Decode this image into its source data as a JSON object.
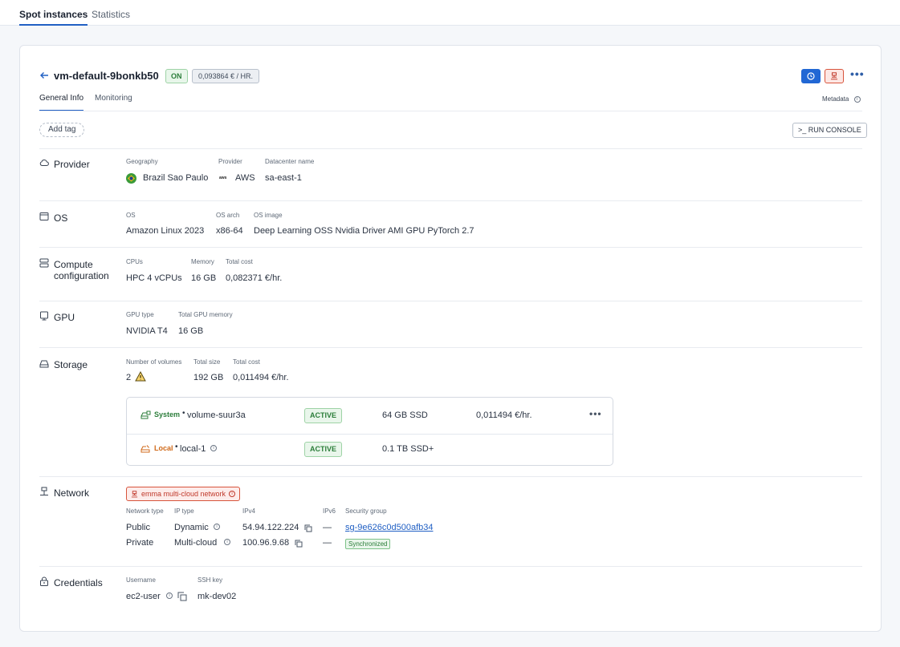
{
  "topnav": {
    "tabs": [
      "Spot instances",
      "Statistics"
    ]
  },
  "header": {
    "vm_name": "vm-default-9bonkb50",
    "status": "ON",
    "price": "0,093864 € / HR.",
    "tabs": [
      "General Info",
      "Monitoring"
    ],
    "metadata_label": "Metadata",
    "add_tag": "Add tag",
    "run_console": ">_ RUN CONSOLE"
  },
  "provider": {
    "title": "Provider",
    "geography_label": "Geography",
    "geography": "Brazil Sao Paulo",
    "provider_label": "Provider",
    "provider": "AWS",
    "provider_logo": "aws",
    "datacenter_label": "Datacenter name",
    "datacenter": "sa-east-1"
  },
  "os": {
    "title": "OS",
    "os_label": "OS",
    "os": "Amazon Linux 2023",
    "arch_label": "OS arch",
    "arch": "x86-64",
    "image_label": "OS image",
    "image": "Deep Learning OSS Nvidia Driver AMI GPU PyTorch 2.7"
  },
  "compute": {
    "title_line1": "Compute",
    "title_line2": "configuration",
    "cpus_label": "CPUs",
    "cpus": "HPC 4 vCPUs",
    "memory_label": "Memory",
    "memory": "16 GB",
    "cost_label": "Total cost",
    "cost": "0,082371 €/hr."
  },
  "gpu": {
    "title": "GPU",
    "type_label": "GPU type",
    "type": "NVIDIA T4",
    "memory_label": "Total GPU memory",
    "memory": "16 GB"
  },
  "storage": {
    "title": "Storage",
    "volumes_label": "Number of volumes",
    "volumes": "2",
    "size_label": "Total size",
    "size": "192 GB",
    "cost_label": "Total cost",
    "cost": "0,011494 €/hr.",
    "rows": [
      {
        "kind": "System",
        "name": "volume-suur3a",
        "status": "ACTIVE",
        "size": "64 GB SSD",
        "cost": "0,011494 €/hr."
      },
      {
        "kind": "Local",
        "name": "local-1",
        "status": "ACTIVE",
        "size": "0.1 TB SSD+",
        "cost": ""
      }
    ]
  },
  "network": {
    "title": "Network",
    "badge": "emma multi-cloud network",
    "headers": [
      "Network type",
      "IP type",
      "IPv4",
      "IPv6",
      "Security group"
    ],
    "rows": [
      {
        "type": "Public",
        "ip_type": "Dynamic",
        "ipv4": "54.94.122.224",
        "ipv6": "—",
        "sg": "sg-9e626c0d500afb34"
      },
      {
        "type": "Private",
        "ip_type": "Multi-cloud",
        "ipv4": "100.96.9.68",
        "ipv6": "—",
        "sg": "Synchronized"
      }
    ]
  },
  "credentials": {
    "title": "Credentials",
    "username_label": "Username",
    "username": "ec2-user",
    "ssh_label": "SSH key",
    "ssh": "mk-dev02"
  },
  "colors": {
    "accent": "#2160c4",
    "success": "#2b7d3a",
    "danger": "#d8543c"
  }
}
